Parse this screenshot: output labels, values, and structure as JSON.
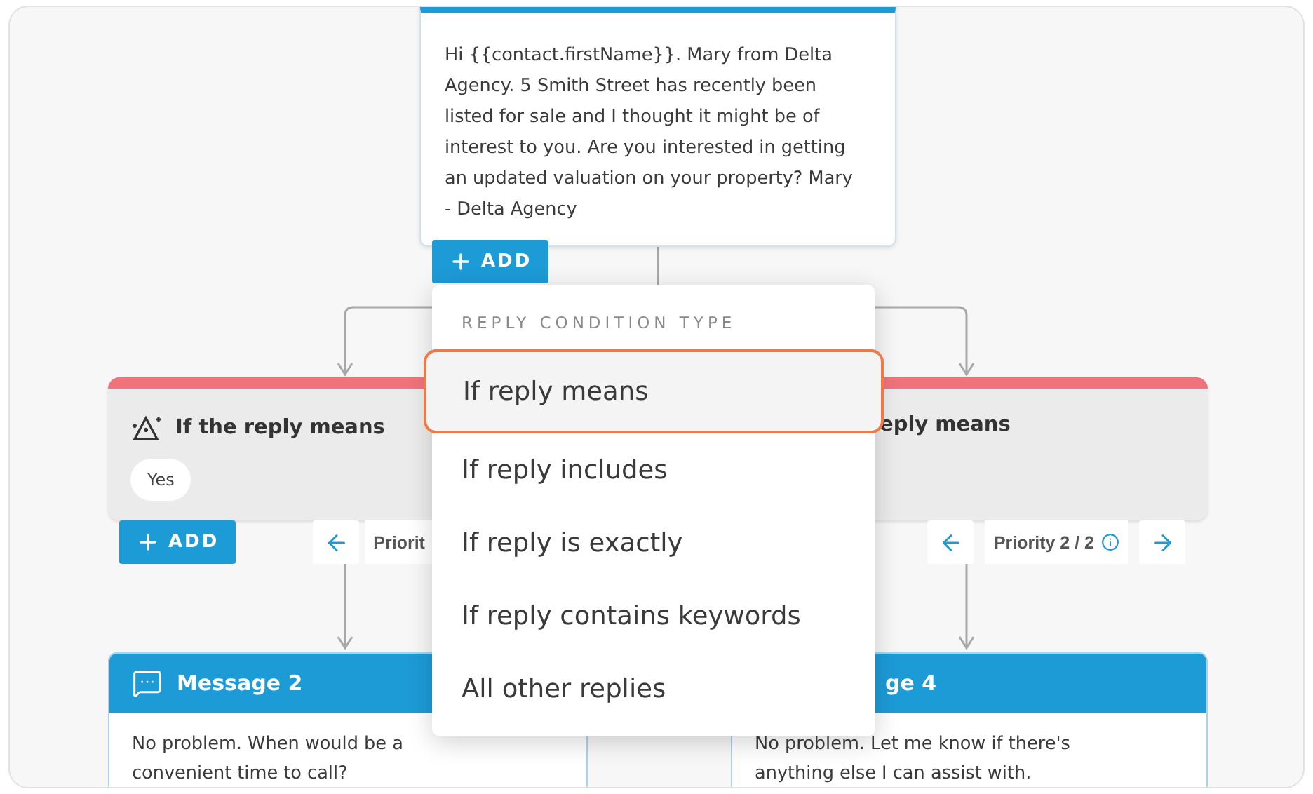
{
  "top_message": {
    "text": "Hi {{contact.firstName}}. Mary from Delta Agency. 5 Smith Street has recently been listed for sale and I thought it might be of interest to you. Are you interested in getting an updated valuation on your property? Mary - Delta Agency",
    "add_button": "ADD"
  },
  "conditions": [
    {
      "icon": true,
      "title": "If the reply means",
      "tags": [
        "Yes"
      ],
      "add_button": "ADD",
      "priority": "Priorit",
      "info": false
    },
    {
      "icon": false,
      "title": "eply means",
      "priority": "Priority 2 / 2",
      "info": true
    }
  ],
  "messages": [
    {
      "icon": true,
      "title": "Message 2",
      "text": "No problem. When would be a convenient time to call?"
    },
    {
      "icon": false,
      "title": "ge 4",
      "text": "No problem. Let me know if there's anything else I can assist with."
    }
  ],
  "menu": {
    "heading": "REPLY CONDITION TYPE",
    "items": [
      {
        "label": "If reply means",
        "selected": true
      },
      {
        "label": "If reply includes",
        "selected": false
      },
      {
        "label": "If reply is exactly",
        "selected": false
      },
      {
        "label": "If reply contains keywords",
        "selected": false
      },
      {
        "label": "All other replies",
        "selected": false
      }
    ]
  }
}
